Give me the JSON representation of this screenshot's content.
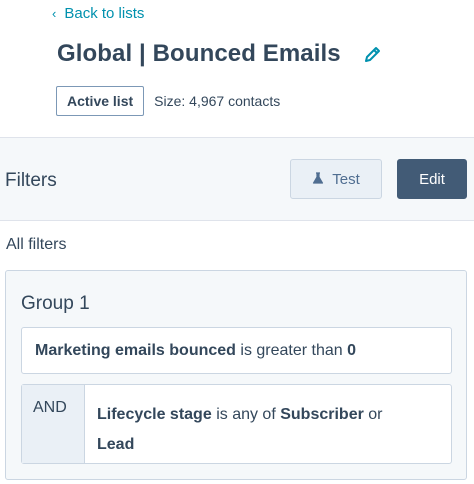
{
  "nav": {
    "back_label": "Back to lists"
  },
  "header": {
    "title": "Global | Bounced Emails",
    "badge": "Active list",
    "size_text": "Size: 4,967 contacts"
  },
  "filters_section": {
    "title": "Filters",
    "test_label": "Test",
    "edit_label": "Edit",
    "all_filters_label": "All filters"
  },
  "group": {
    "title": "Group 1",
    "filter1": {
      "property": "Marketing emails bounced",
      "operator": "is greater than",
      "value": "0"
    },
    "filter2": {
      "conjunction": "AND",
      "property": "Lifecycle stage",
      "operator": "is any of",
      "value1": "Subscriber",
      "joiner": "or",
      "value2": "Lead"
    }
  },
  "colors": {
    "link": "#0091ae",
    "primary_button": "#425b76",
    "text": "#33475b",
    "panel": "#f5f8fa"
  },
  "icons": {
    "back": "chevron-left-icon",
    "edit": "pencil-icon",
    "test": "flask-icon"
  }
}
